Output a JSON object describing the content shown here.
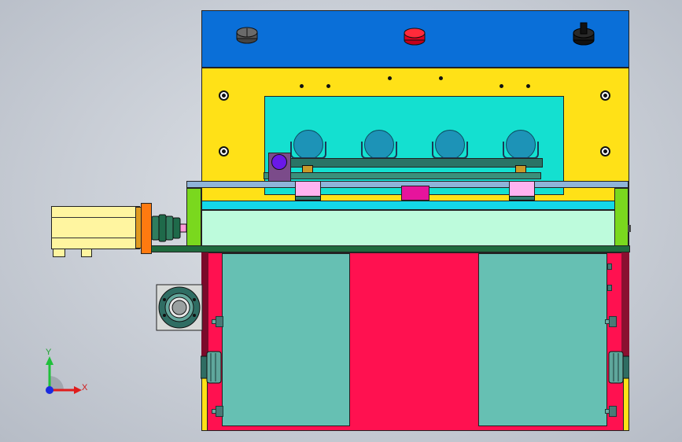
{
  "viewport": {
    "triad": {
      "x_label": "X",
      "y_label": "Y"
    }
  },
  "colors": {
    "top_plate": "#0a6fd8",
    "frame": "#ffe117",
    "window": "#14e0d0",
    "base": "#ff1150",
    "side_panel": "#66c0b3",
    "motor": "#fff5a0",
    "rail": "#bdfbdc"
  },
  "icons": {
    "buttons": [
      "grey-push-button-icon",
      "red-push-button-icon",
      "black-selector-switch-icon"
    ],
    "triad": "coordinate-triad-icon"
  }
}
